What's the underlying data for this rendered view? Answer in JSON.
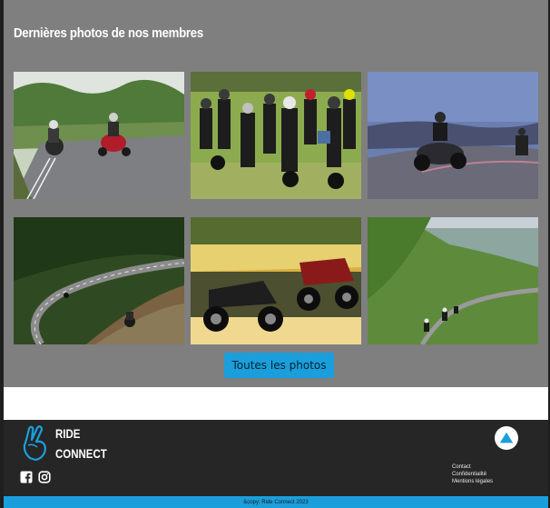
{
  "gallery": {
    "title": "Dernières photos de nos membres",
    "button_label": "Toutes les photos",
    "photos": [
      {
        "subject": "two riders on countryside road"
      },
      {
        "subject": "group of riders at gathering"
      },
      {
        "subject": "riders on mountain road at dusk"
      },
      {
        "subject": "winding road through forest hills"
      },
      {
        "subject": "parked motorcycles by the sea"
      },
      {
        "subject": "riders on green valley road"
      }
    ]
  },
  "footer": {
    "brand_line1": "RIDE",
    "brand_line2": "CONNECT",
    "links": [
      "Contact",
      "Confidentialité",
      "Mentions légales"
    ],
    "copyright": "&copy; Ride Connect 2023"
  },
  "colors": {
    "accent": "#1a9fdc",
    "gallery_bg": "#7f7f7f",
    "footer_bg": "#262626"
  },
  "icons": {
    "logo": "peace-hand-icon",
    "social": [
      "facebook-icon",
      "instagram-icon"
    ],
    "scroll_top": "arrow-up-icon"
  }
}
